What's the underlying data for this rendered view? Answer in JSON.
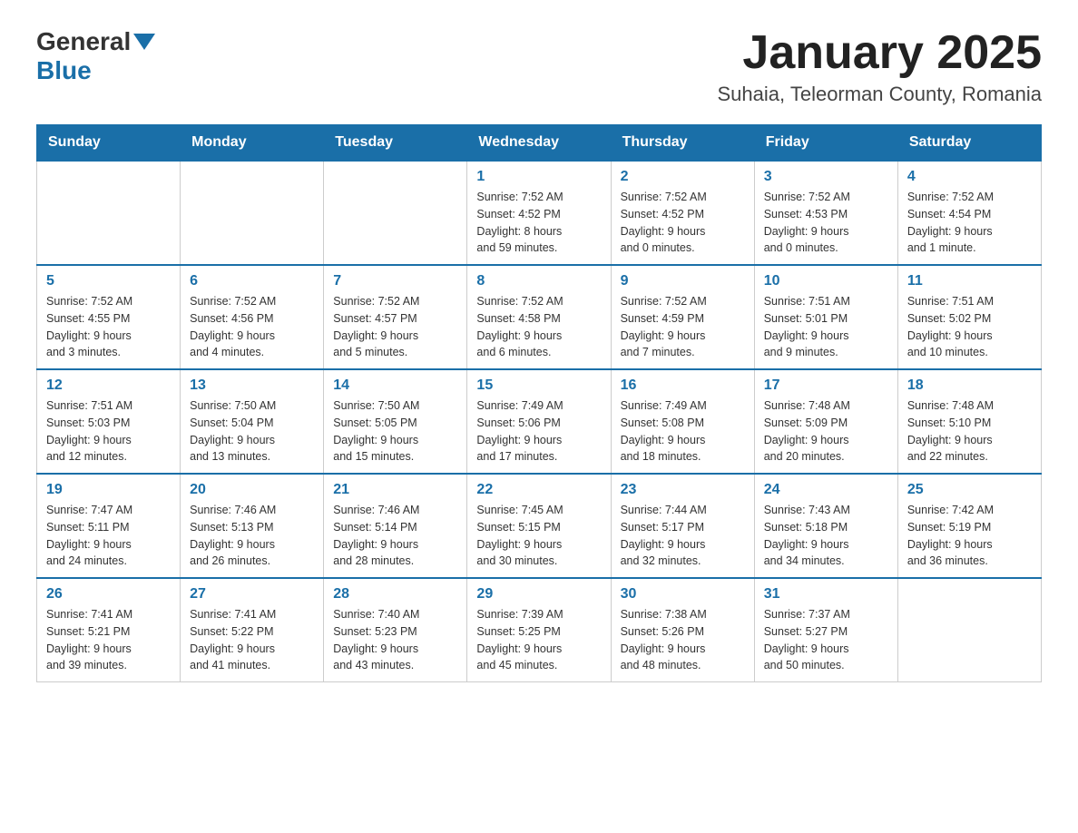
{
  "header": {
    "logo_general": "General",
    "logo_blue": "Blue",
    "month_title": "January 2025",
    "location": "Suhaia, Teleorman County, Romania"
  },
  "days_of_week": [
    "Sunday",
    "Monday",
    "Tuesday",
    "Wednesday",
    "Thursday",
    "Friday",
    "Saturday"
  ],
  "weeks": [
    [
      {
        "day": "",
        "info": ""
      },
      {
        "day": "",
        "info": ""
      },
      {
        "day": "",
        "info": ""
      },
      {
        "day": "1",
        "info": "Sunrise: 7:52 AM\nSunset: 4:52 PM\nDaylight: 8 hours\nand 59 minutes."
      },
      {
        "day": "2",
        "info": "Sunrise: 7:52 AM\nSunset: 4:52 PM\nDaylight: 9 hours\nand 0 minutes."
      },
      {
        "day": "3",
        "info": "Sunrise: 7:52 AM\nSunset: 4:53 PM\nDaylight: 9 hours\nand 0 minutes."
      },
      {
        "day": "4",
        "info": "Sunrise: 7:52 AM\nSunset: 4:54 PM\nDaylight: 9 hours\nand 1 minute."
      }
    ],
    [
      {
        "day": "5",
        "info": "Sunrise: 7:52 AM\nSunset: 4:55 PM\nDaylight: 9 hours\nand 3 minutes."
      },
      {
        "day": "6",
        "info": "Sunrise: 7:52 AM\nSunset: 4:56 PM\nDaylight: 9 hours\nand 4 minutes."
      },
      {
        "day": "7",
        "info": "Sunrise: 7:52 AM\nSunset: 4:57 PM\nDaylight: 9 hours\nand 5 minutes."
      },
      {
        "day": "8",
        "info": "Sunrise: 7:52 AM\nSunset: 4:58 PM\nDaylight: 9 hours\nand 6 minutes."
      },
      {
        "day": "9",
        "info": "Sunrise: 7:52 AM\nSunset: 4:59 PM\nDaylight: 9 hours\nand 7 minutes."
      },
      {
        "day": "10",
        "info": "Sunrise: 7:51 AM\nSunset: 5:01 PM\nDaylight: 9 hours\nand 9 minutes."
      },
      {
        "day": "11",
        "info": "Sunrise: 7:51 AM\nSunset: 5:02 PM\nDaylight: 9 hours\nand 10 minutes."
      }
    ],
    [
      {
        "day": "12",
        "info": "Sunrise: 7:51 AM\nSunset: 5:03 PM\nDaylight: 9 hours\nand 12 minutes."
      },
      {
        "day": "13",
        "info": "Sunrise: 7:50 AM\nSunset: 5:04 PM\nDaylight: 9 hours\nand 13 minutes."
      },
      {
        "day": "14",
        "info": "Sunrise: 7:50 AM\nSunset: 5:05 PM\nDaylight: 9 hours\nand 15 minutes."
      },
      {
        "day": "15",
        "info": "Sunrise: 7:49 AM\nSunset: 5:06 PM\nDaylight: 9 hours\nand 17 minutes."
      },
      {
        "day": "16",
        "info": "Sunrise: 7:49 AM\nSunset: 5:08 PM\nDaylight: 9 hours\nand 18 minutes."
      },
      {
        "day": "17",
        "info": "Sunrise: 7:48 AM\nSunset: 5:09 PM\nDaylight: 9 hours\nand 20 minutes."
      },
      {
        "day": "18",
        "info": "Sunrise: 7:48 AM\nSunset: 5:10 PM\nDaylight: 9 hours\nand 22 minutes."
      }
    ],
    [
      {
        "day": "19",
        "info": "Sunrise: 7:47 AM\nSunset: 5:11 PM\nDaylight: 9 hours\nand 24 minutes."
      },
      {
        "day": "20",
        "info": "Sunrise: 7:46 AM\nSunset: 5:13 PM\nDaylight: 9 hours\nand 26 minutes."
      },
      {
        "day": "21",
        "info": "Sunrise: 7:46 AM\nSunset: 5:14 PM\nDaylight: 9 hours\nand 28 minutes."
      },
      {
        "day": "22",
        "info": "Sunrise: 7:45 AM\nSunset: 5:15 PM\nDaylight: 9 hours\nand 30 minutes."
      },
      {
        "day": "23",
        "info": "Sunrise: 7:44 AM\nSunset: 5:17 PM\nDaylight: 9 hours\nand 32 minutes."
      },
      {
        "day": "24",
        "info": "Sunrise: 7:43 AM\nSunset: 5:18 PM\nDaylight: 9 hours\nand 34 minutes."
      },
      {
        "day": "25",
        "info": "Sunrise: 7:42 AM\nSunset: 5:19 PM\nDaylight: 9 hours\nand 36 minutes."
      }
    ],
    [
      {
        "day": "26",
        "info": "Sunrise: 7:41 AM\nSunset: 5:21 PM\nDaylight: 9 hours\nand 39 minutes."
      },
      {
        "day": "27",
        "info": "Sunrise: 7:41 AM\nSunset: 5:22 PM\nDaylight: 9 hours\nand 41 minutes."
      },
      {
        "day": "28",
        "info": "Sunrise: 7:40 AM\nSunset: 5:23 PM\nDaylight: 9 hours\nand 43 minutes."
      },
      {
        "day": "29",
        "info": "Sunrise: 7:39 AM\nSunset: 5:25 PM\nDaylight: 9 hours\nand 45 minutes."
      },
      {
        "day": "30",
        "info": "Sunrise: 7:38 AM\nSunset: 5:26 PM\nDaylight: 9 hours\nand 48 minutes."
      },
      {
        "day": "31",
        "info": "Sunrise: 7:37 AM\nSunset: 5:27 PM\nDaylight: 9 hours\nand 50 minutes."
      },
      {
        "day": "",
        "info": ""
      }
    ]
  ]
}
